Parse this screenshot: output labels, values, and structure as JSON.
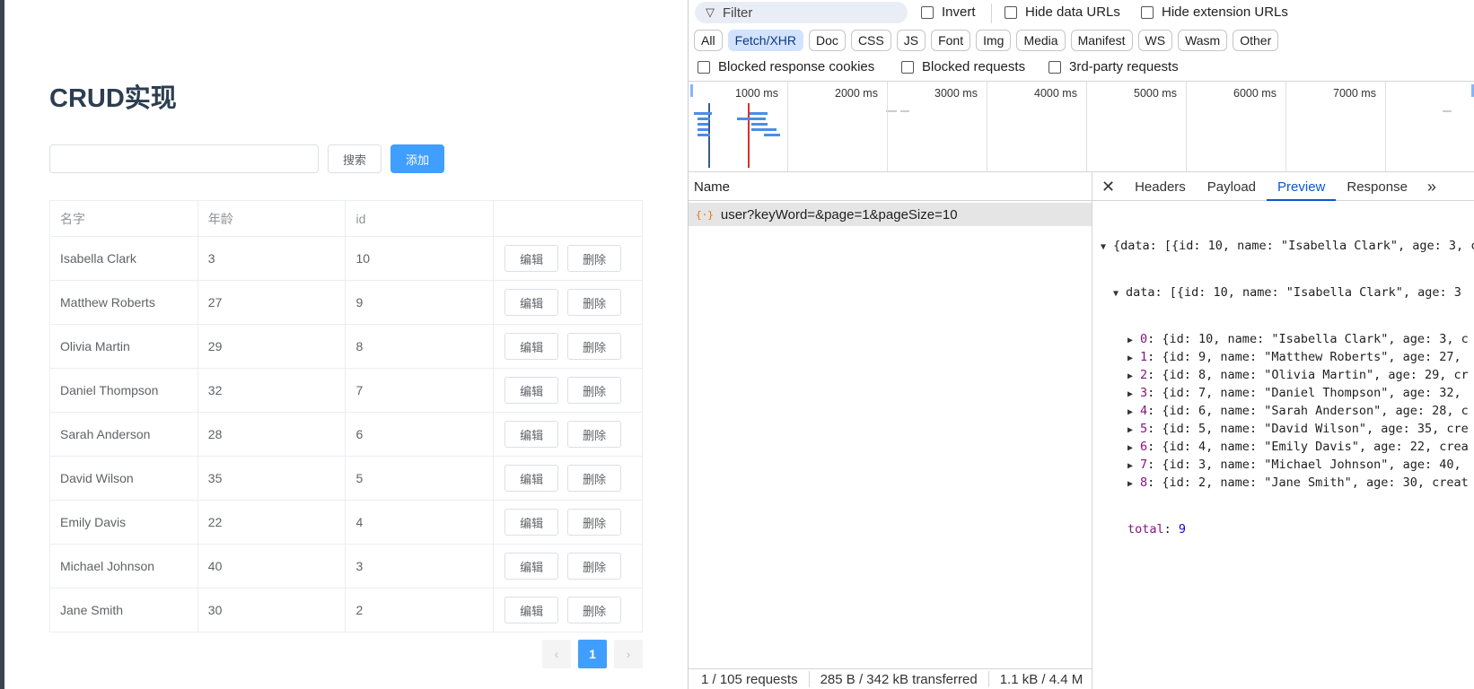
{
  "app": {
    "title": "CRUD实现",
    "search": {
      "value": "",
      "placeholder": "",
      "button": "搜索"
    },
    "add_button": "添加",
    "table": {
      "headers": [
        "名字",
        "年龄",
        "id",
        ""
      ],
      "edit_label": "编辑",
      "delete_label": "删除",
      "rows": [
        {
          "name": "Isabella Clark",
          "age": "3",
          "id": "10"
        },
        {
          "name": "Matthew Roberts",
          "age": "27",
          "id": "9"
        },
        {
          "name": "Olivia Martin",
          "age": "29",
          "id": "8"
        },
        {
          "name": "Daniel Thompson",
          "age": "32",
          "id": "7"
        },
        {
          "name": "Sarah Anderson",
          "age": "28",
          "id": "6"
        },
        {
          "name": "David Wilson",
          "age": "35",
          "id": "5"
        },
        {
          "name": "Emily Davis",
          "age": "22",
          "id": "4"
        },
        {
          "name": "Michael Johnson",
          "age": "40",
          "id": "3"
        },
        {
          "name": "Jane Smith",
          "age": "30",
          "id": "2"
        }
      ]
    },
    "pagination": {
      "prev": "‹",
      "current": "1",
      "next": "›"
    }
  },
  "devtools": {
    "filter_placeholder": "Filter",
    "checkboxes": {
      "invert": "Invert",
      "hide_data_urls": "Hide data URLs",
      "hide_extension_urls": "Hide extension URLs",
      "blocked_cookies": "Blocked response cookies",
      "blocked_requests": "Blocked requests",
      "third_party": "3rd-party requests"
    },
    "type_filters": [
      "All",
      "Fetch/XHR",
      "Doc",
      "CSS",
      "JS",
      "Font",
      "Img",
      "Media",
      "Manifest",
      "WS",
      "Wasm",
      "Other"
    ],
    "active_type": "Fetch/XHR",
    "timeline_ticks": [
      "1000 ms",
      "2000 ms",
      "3000 ms",
      "4000 ms",
      "5000 ms",
      "6000 ms",
      "7000 ms"
    ],
    "name_header": "Name",
    "request": "user?keyWord=&page=1&pageSize=10",
    "detail_tabs": [
      "Headers",
      "Payload",
      "Preview",
      "Response"
    ],
    "active_tab": "Preview",
    "preview": {
      "root": "{data: [{id: 10, name: \"Isabella Clark\", age: 3, c",
      "data_line": "data: [{id: 10, name: \"Isabella Clark\", age: 3",
      "items": [
        {
          "idx": "0",
          "text": "{id: 10, name: \"Isabella Clark\", age: 3, c"
        },
        {
          "idx": "1",
          "text": "{id: 9, name: \"Matthew Roberts\", age: 27,"
        },
        {
          "idx": "2",
          "text": "{id: 8, name: \"Olivia Martin\", age: 29, cr"
        },
        {
          "idx": "3",
          "text": "{id: 7, name: \"Daniel Thompson\", age: 32,"
        },
        {
          "idx": "4",
          "text": "{id: 6, name: \"Sarah Anderson\", age: 28, c"
        },
        {
          "idx": "5",
          "text": "{id: 5, name: \"David Wilson\", age: 35, cre"
        },
        {
          "idx": "6",
          "text": "{id: 4, name: \"Emily Davis\", age: 22, crea"
        },
        {
          "idx": "7",
          "text": "{id: 3, name: \"Michael Johnson\", age: 40,"
        },
        {
          "idx": "8",
          "text": "{id: 2, name: \"Jane Smith\", age: 30, creat"
        }
      ],
      "total_key": "total",
      "total_value": "9"
    },
    "status": {
      "requests": "1 / 105 requests",
      "transferred": "285 B / 342 kB transferred",
      "resources": "1.1 kB / 4.4 M"
    }
  }
}
